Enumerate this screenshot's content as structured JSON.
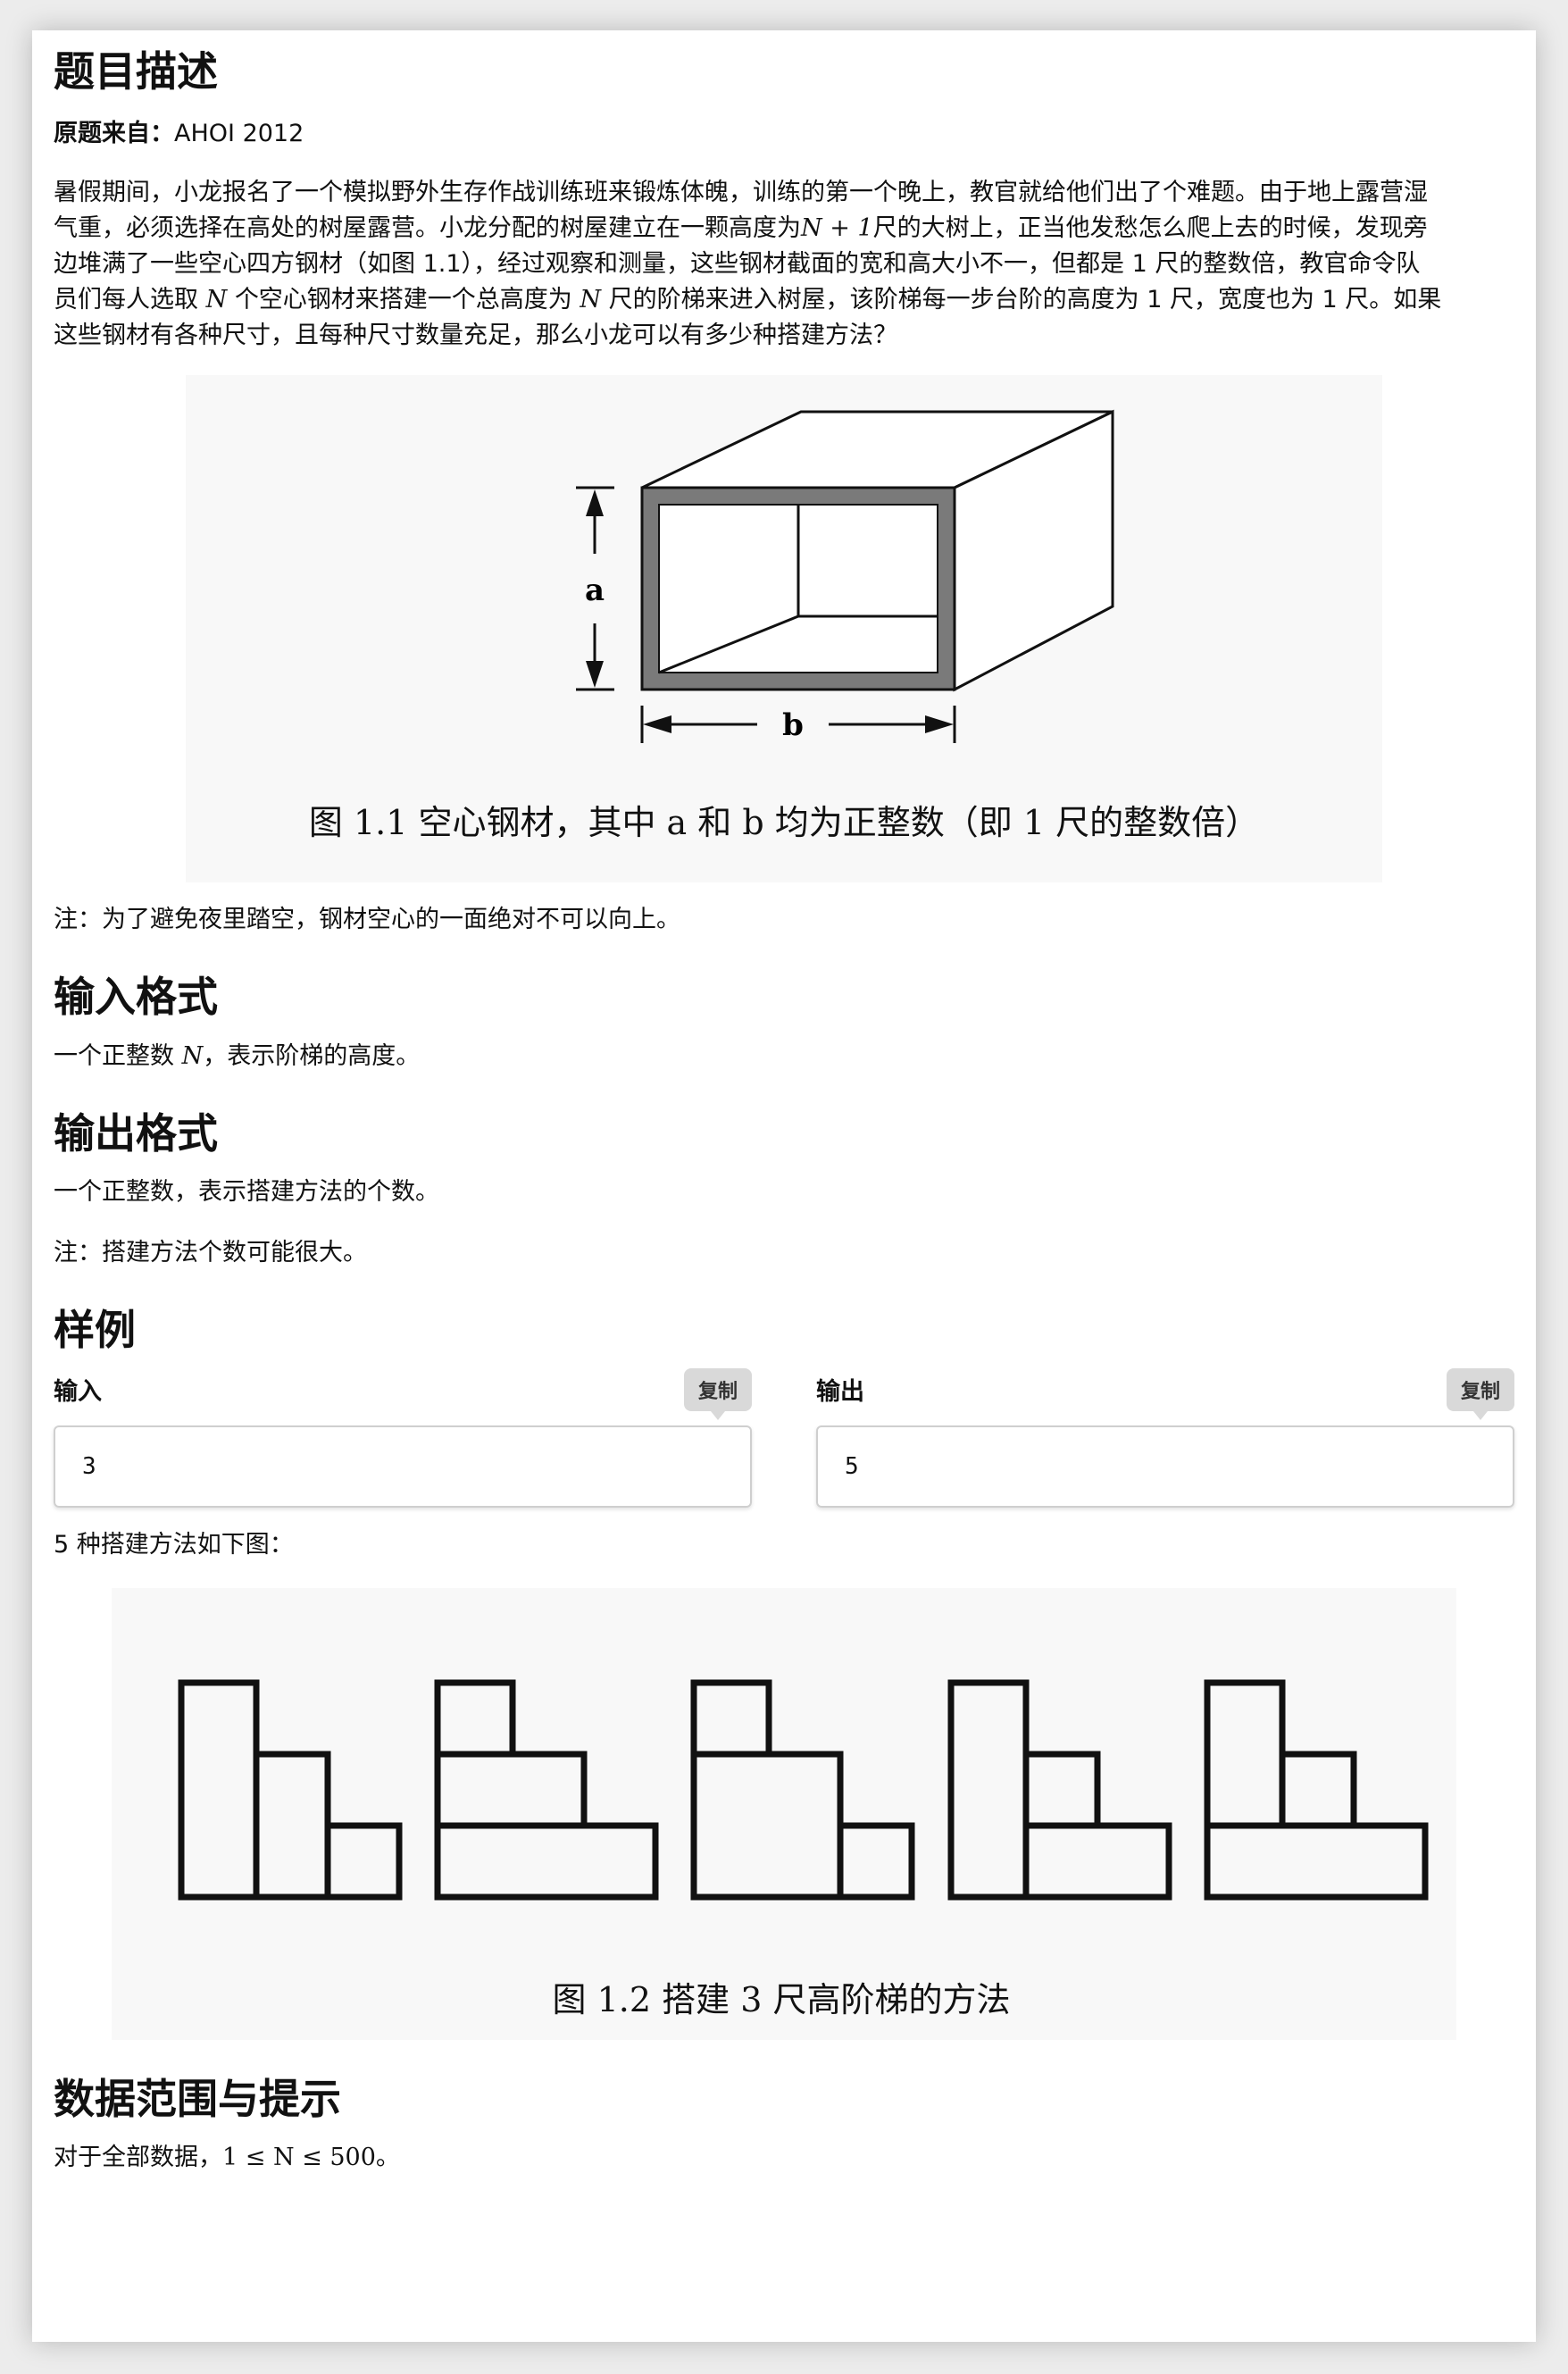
{
  "sections": {
    "description_title": "题目描述",
    "input_title": "输入格式",
    "output_title": "输出格式",
    "sample_title": "样例",
    "range_title": "数据范围与提示"
  },
  "source": {
    "label": "原题来自：",
    "value": "AHOI 2012"
  },
  "description": {
    "p1": "暑假期间，小龙报名了一个模拟野外生存作战训练班来锻炼体魄，训练的第一个晚上，教官就给他们出了个难题。由于地上露营湿",
    "p2": "气重，必须选择在高处的树屋露营。小龙分配的树屋建立在一颗高度为",
    "p2m": "N + 1",
    "p2b": "尺的大树上，正当他发愁怎么爬上去的时候，发现旁",
    "p3": "边堆满了一些空心四方钢材（如图 1.1），经过观察和测量，这些钢材截面的宽和高大小不一，但都是 1 尺的整数倍，教官命令队",
    "p4a": "员们每人选取",
    "p4m1": "N",
    "p4b": "个空心钢材来搭建一个总高度为",
    "p4m2": "N",
    "p4c": "尺的阶梯来进入树屋，该阶梯每一步台阶的高度为 1 尺，宽度也为 1 尺。如果",
    "p5": "这些钢材有各种尺寸，且每种尺寸数量充足，那么小龙可以有多少种搭建方法？",
    "note": "注：为了避免夜里踏空，钢材空心的一面绝对不可以向上。"
  },
  "figure1": {
    "label_a": "a",
    "label_b": "b",
    "caption": "图 1.1  空心钢材，其中 a 和 b 均为正整数（即 1 尺的整数倍）"
  },
  "input_format": {
    "a": "一个正整数",
    "m": "N",
    "b": "，表示阶梯的高度。"
  },
  "output_format": {
    "text": "一个正整数，表示搭建方法的个数。",
    "note": "注：搭建方法个数可能很大。"
  },
  "sample": {
    "input_label": "输入",
    "output_label": "输出",
    "copy_label": "复制",
    "input_value": "3",
    "output_value": "5",
    "explain": "5 种搭建方法如下图："
  },
  "figure2": {
    "caption": "图 1.2  搭建 3 尺高阶梯的方法"
  },
  "range": {
    "a": "对于全部数据，",
    "m": "1 ≤ N ≤ 500",
    "b": "。"
  },
  "colors": {
    "steel_gray": "#7a7a7a",
    "copy_bg": "#d9d9d9"
  }
}
